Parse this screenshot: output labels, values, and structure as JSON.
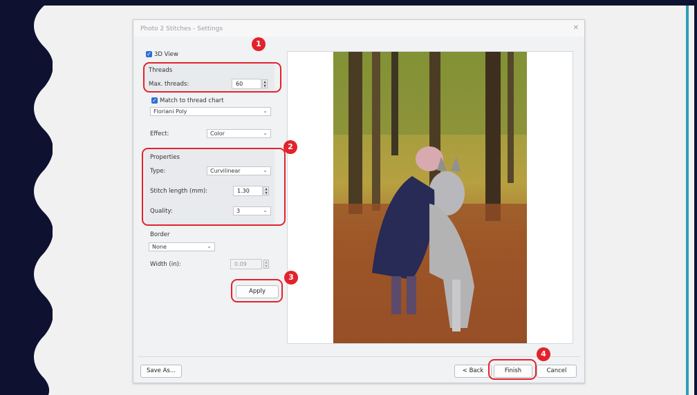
{
  "dialog": {
    "title": "Photo 2 Stitches - Settings",
    "close_glyph": "✕"
  },
  "view_3d": {
    "label": "3D View",
    "checked": true
  },
  "threads": {
    "heading": "Threads",
    "max_label": "Max. threads:",
    "max_value": "60"
  },
  "match": {
    "label": "Match to thread chart",
    "checked": true
  },
  "thread_chart": {
    "value": "Floriani Poly"
  },
  "effect": {
    "label": "Effect:",
    "value": "Color"
  },
  "properties": {
    "heading": "Properties",
    "type_label": "Type:",
    "type_value": "Curvilinear",
    "stitch_label": "Stitch length (mm):",
    "stitch_value": "1.30",
    "quality_label": "Quality:",
    "quality_value": "3"
  },
  "border": {
    "heading": "Border",
    "value": "None",
    "width_label": "Width (in):",
    "width_value": "0.09"
  },
  "buttons": {
    "apply": "Apply",
    "save_as": "Save As...",
    "back": "< Back",
    "finish": "Finish",
    "cancel": "Cancel"
  },
  "badges": [
    "1",
    "2",
    "3",
    "4"
  ],
  "colors": {
    "highlight": "#e1232b",
    "accent": "#2d9fb5",
    "checkbox": "#2f6ed7",
    "background": "#0e1130"
  }
}
